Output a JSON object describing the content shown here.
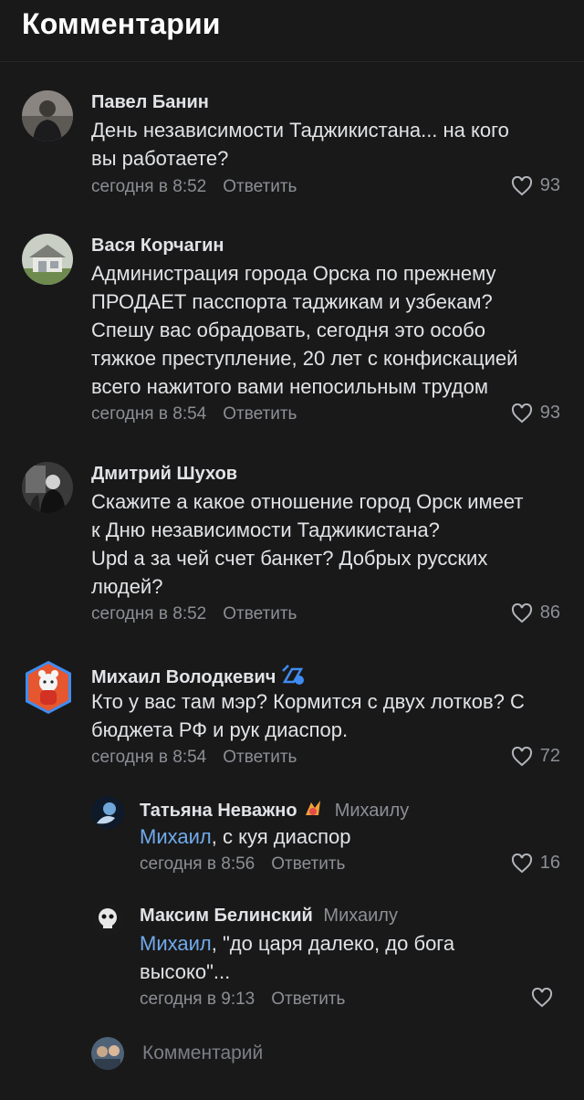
{
  "header": {
    "title": "Комментарии"
  },
  "comments": [
    {
      "author": "Павел Банин",
      "lines": [
        "День независимости Таджикистана... на кого",
        "вы работаете?"
      ],
      "time": "сегодня в 8:52",
      "reply_label": "Ответить",
      "likes": "93"
    },
    {
      "author": "Вася Корчагин",
      "lines": [
        "Администрация города Орска по прежнему",
        "ПРОДАЕТ пасспорта таджикам и узбекам?",
        "Спешу вас обрадовать, сегодня это особо",
        "тяжкое преступление, 20 лет с конфискацией",
        "всего нажитого вами непосильным трудом"
      ],
      "time": "сегодня в 8:54",
      "reply_label": "Ответить",
      "likes": "93"
    },
    {
      "author": "Дмитрий Шухов",
      "lines": [
        "Скажите а какое отношение город Орск имеет",
        "к Дню независимости Таджикистана?",
        "Upd а за чей счет банкет? Добрых русских",
        "людей?"
      ],
      "time": "сегодня в 8:52",
      "reply_label": "Ответить",
      "likes": "86"
    },
    {
      "author": "Михаил Володкевич",
      "lines": [
        "Кто у вас там мэр? Кормится с двух лотков? С",
        "бюджета РФ и рук диаспор."
      ],
      "time": "сегодня в 8:54",
      "reply_label": "Ответить",
      "likes": "72"
    }
  ],
  "replies": [
    {
      "author": "Татьяна Неважно",
      "reply_to": "Михаилу",
      "mention": "Михаил",
      "lines": [
        ", с куя диаспор"
      ],
      "time": "сегодня в 8:56",
      "reply_label": "Ответить",
      "likes": "16"
    },
    {
      "author": "Максим Белинский",
      "reply_to": "Михаилу",
      "mention": "Михаил",
      "lines": [
        ", \"до царя далеко, до бога",
        "высоко\"..."
      ],
      "time": "сегодня в 9:13",
      "reply_label": "Ответить",
      "likes": ""
    }
  ],
  "composer": {
    "placeholder": "Комментарий"
  },
  "colors": {
    "background": "#19191a",
    "text": "#e1e3e6",
    "secondary": "#8c8f94",
    "mention": "#71aaeb"
  }
}
